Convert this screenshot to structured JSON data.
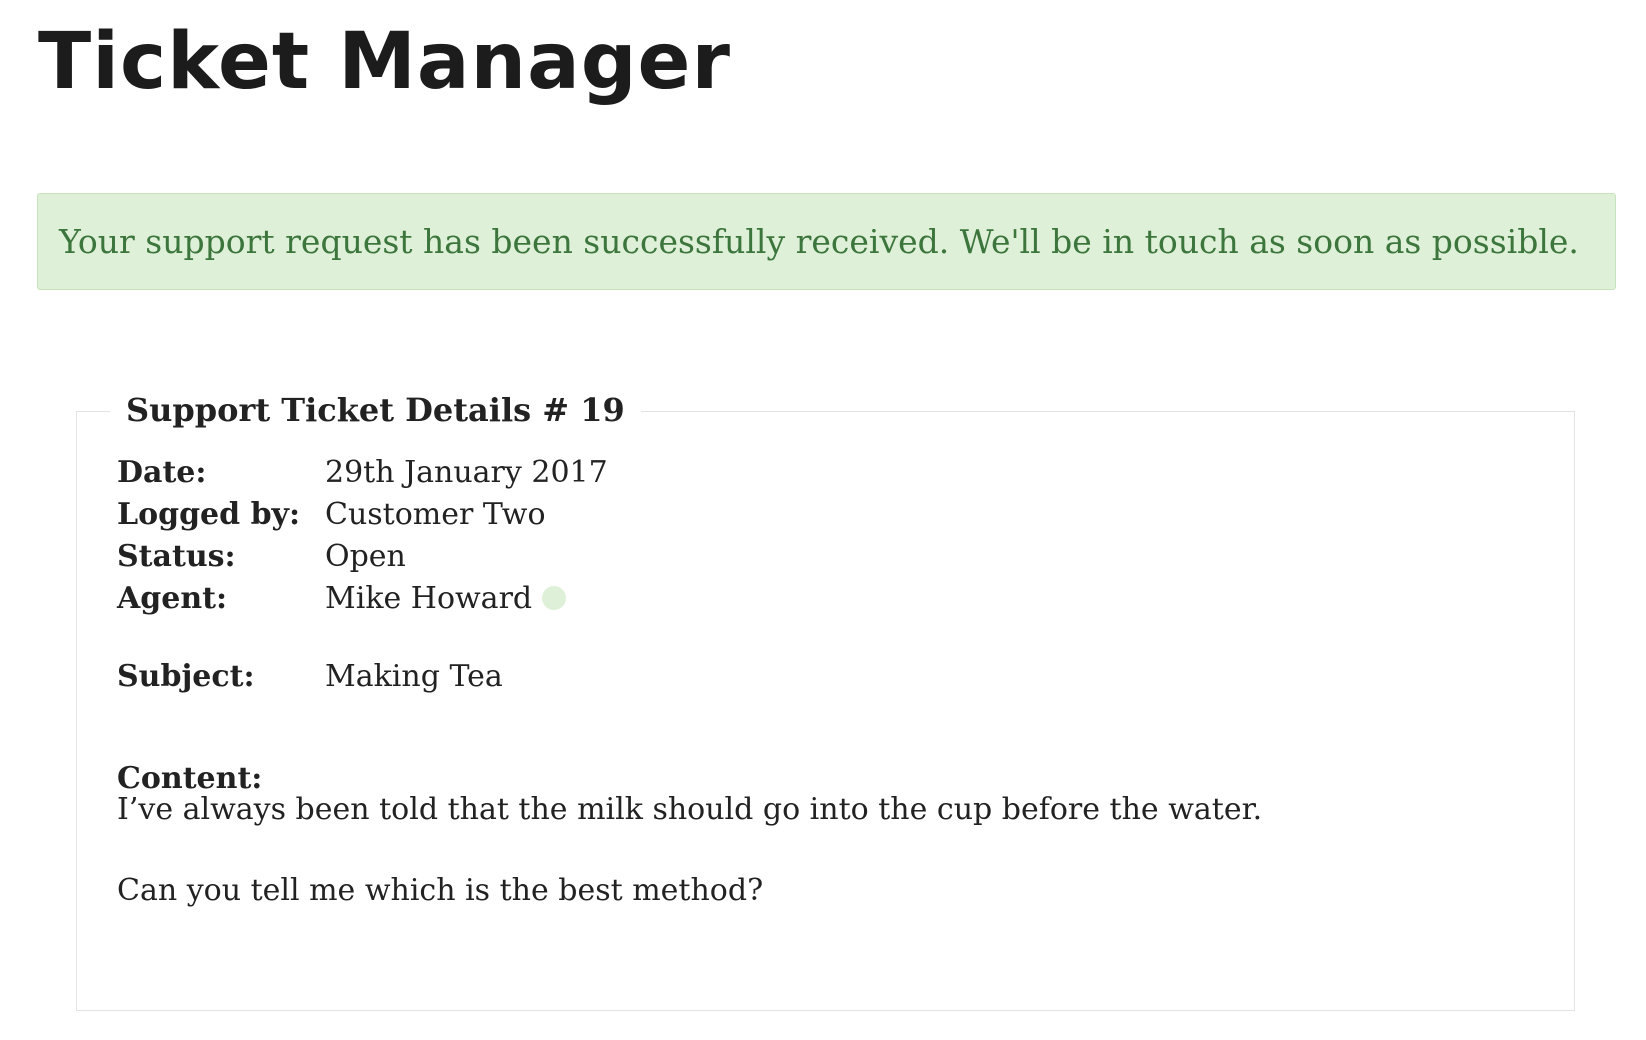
{
  "app": {
    "title": "Ticket Manager"
  },
  "alert": {
    "message": "Your support request has been successfully received. We'll be in touch as soon as possible.",
    "background_color": "#dff0d8",
    "text_color": "#3c763d"
  },
  "ticket": {
    "legend": "Support Ticket Details # 19",
    "fields": {
      "date": {
        "label": "Date:",
        "value": "29th January 2017"
      },
      "logged_by": {
        "label": "Logged by:",
        "value": "Customer Two"
      },
      "status": {
        "label": "Status:",
        "value": "Open"
      },
      "agent": {
        "label": "Agent:",
        "value": "Mike Howard",
        "indicator_icon": "online-status-dot-icon"
      },
      "subject": {
        "label": "Subject:",
        "value": "Making Tea"
      }
    },
    "content": {
      "label": "Content:",
      "lines": [
        "I’ve always been told that the milk should go into the cup before the water.",
        "Can you tell me which is the best method?"
      ]
    }
  }
}
